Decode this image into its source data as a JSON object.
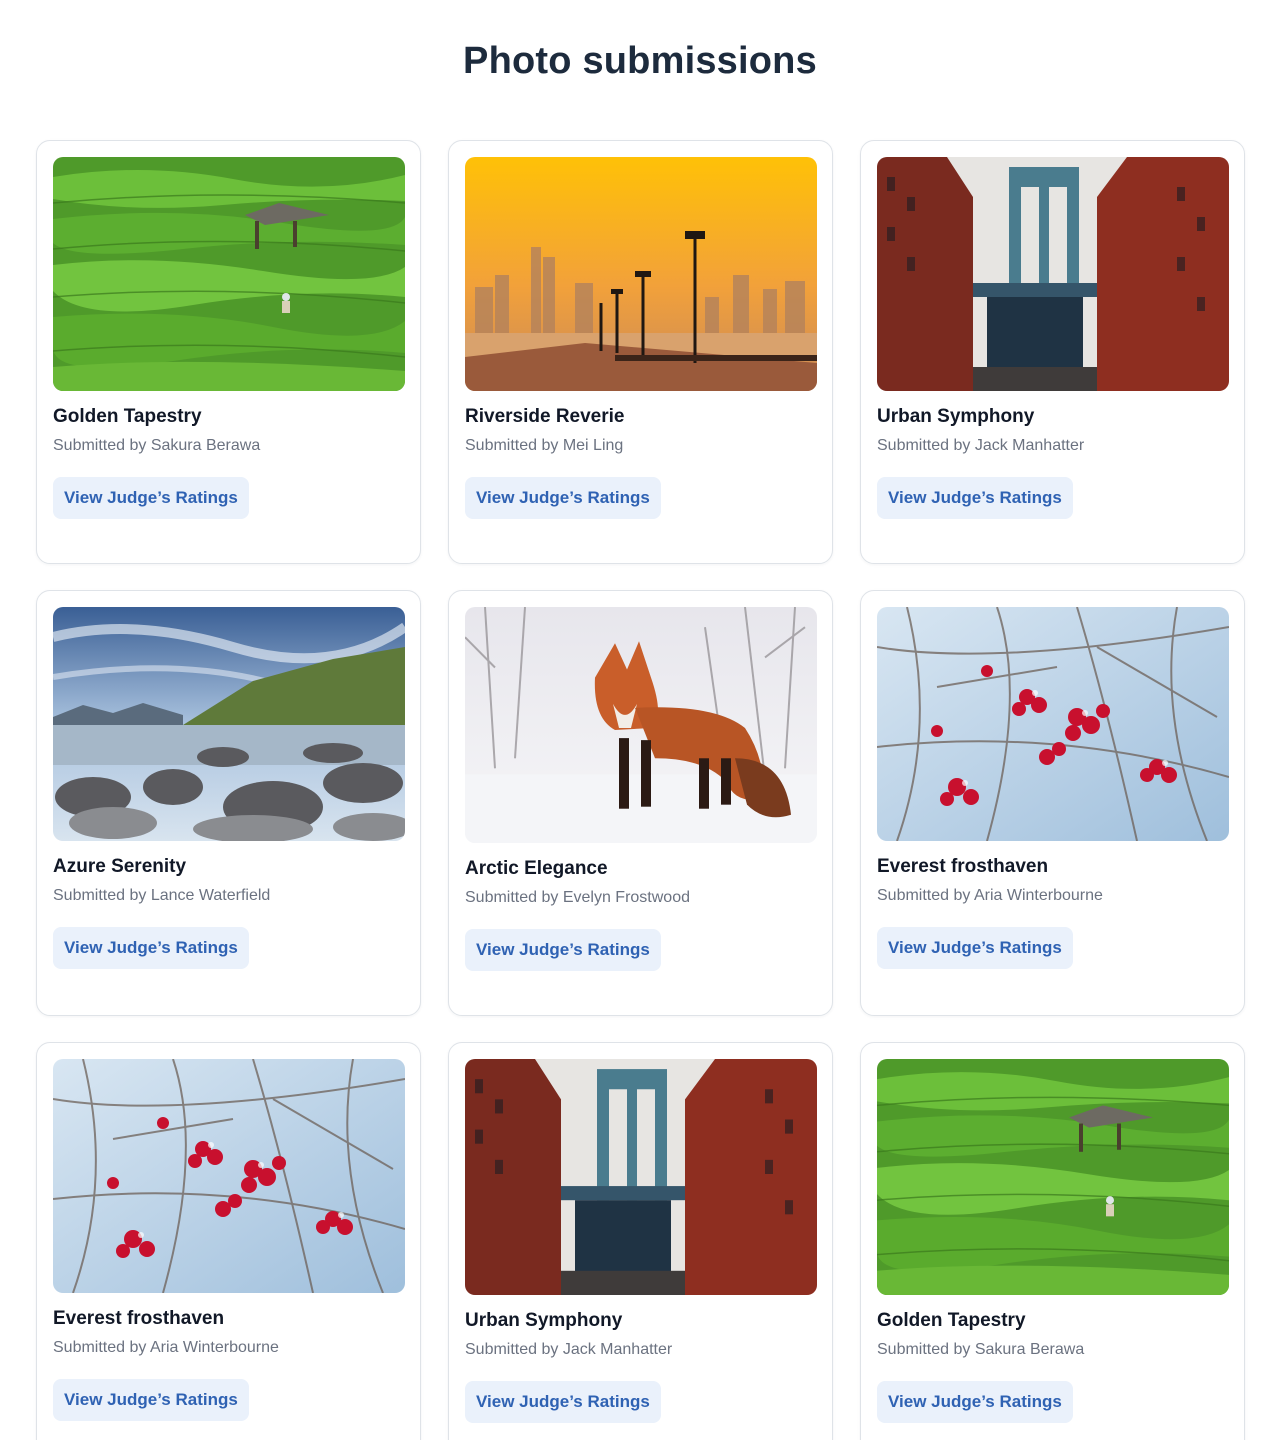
{
  "page": {
    "title": "Photo submissions"
  },
  "submissions": [
    {
      "title": "Golden Tapestry",
      "submitter": "Submitted by Sakura Berawa",
      "button": "View Judge’s Ratings",
      "image": "rice-terraces-photo"
    },
    {
      "title": "Riverside Reverie",
      "submitter": "Submitted by Mei Ling",
      "button": "View Judge’s Ratings",
      "image": "sunset-riverside-photo"
    },
    {
      "title": "Urban Symphony",
      "submitter": "Submitted by Jack Manhatter",
      "button": "View Judge’s Ratings",
      "image": "bridge-street-photo"
    },
    {
      "title": "Azure Serenity",
      "submitter": "Submitted by Lance Waterfield",
      "button": "View Judge’s Ratings",
      "image": "rocky-coast-photo"
    },
    {
      "title": "Arctic Elegance",
      "submitter": "Submitted by Evelyn Frostwood",
      "button": "View Judge’s Ratings",
      "image": "red-fox-snow-photo"
    },
    {
      "title": "Everest frosthaven",
      "submitter": "Submitted by Aria Winterbourne",
      "button": "View Judge’s Ratings",
      "image": "frosted-berries-photo"
    },
    {
      "title": "Everest frosthaven",
      "submitter": "Submitted by Aria Winterbourne",
      "button": "View Judge’s Ratings",
      "image": "frosted-berries-photo"
    },
    {
      "title": "Urban Symphony",
      "submitter": "Submitted by Jack Manhatter",
      "button": "View Judge’s Ratings",
      "image": "bridge-street-photo"
    },
    {
      "title": "Golden Tapestry",
      "submitter": "Submitted by Sakura Berawa",
      "button": "View Judge’s Ratings",
      "image": "rice-terraces-photo"
    }
  ],
  "colors": {
    "accent": "#2f62b3",
    "button_bg": "#eaf1fb",
    "title": "#1d2b3d",
    "muted": "#6b7280",
    "border": "#dfe3e8"
  }
}
